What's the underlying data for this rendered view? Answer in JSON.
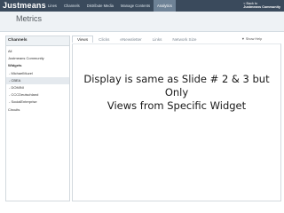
{
  "app": {
    "logo": "Justmeans",
    "nav": [
      "Lines",
      "Channels",
      "Distribute Media",
      "Manage Contents",
      "Analytics"
    ],
    "active_nav_index": 4,
    "back_link": [
      "< Back to",
      "Justmeans Community"
    ]
  },
  "page": {
    "title": "Metrics"
  },
  "sidebar": {
    "header": "Channels",
    "items": [
      {
        "label": "All"
      },
      {
        "label": "Justmeans Community"
      },
      {
        "label": "Widgets"
      },
      {
        "label": "- MichaelMuzel"
      },
      {
        "label": "- CBEA"
      },
      {
        "label": "- DOMINI"
      },
      {
        "label": "- CCCDeutschland"
      },
      {
        "label": "- SocialEnterprise"
      },
      {
        "label": "Circuits"
      }
    ],
    "selected_index": 4
  },
  "tabs": [
    "Views",
    "Clicks",
    "eNewsletter",
    "Links",
    "Network Size"
  ],
  "active_tab_index": 0,
  "help": {
    "label": "▼ Show Help"
  },
  "overlay": {
    "line1": "Display is same as Slide # 2 & 3 but",
    "line2": "Only",
    "line3": "Views from Specific Widget"
  },
  "colors": {
    "topbar": "#3a4a5c",
    "active_nav": "#6e8296",
    "subheader": "#eef2f5"
  }
}
